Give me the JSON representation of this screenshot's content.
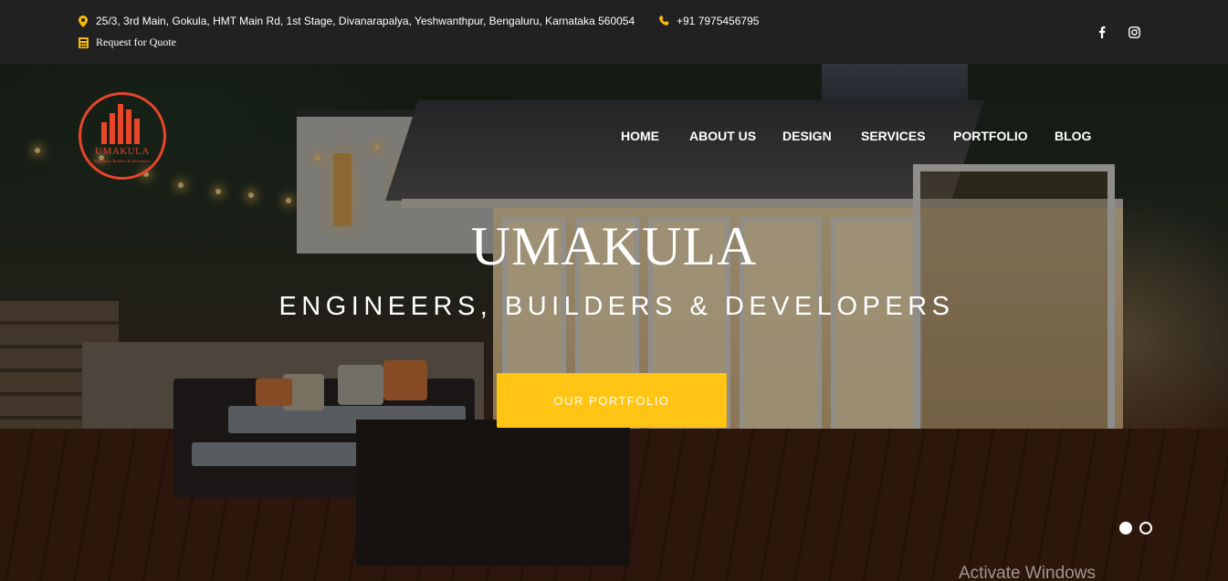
{
  "topbar": {
    "address": "25/3, 3rd Main, Gokula, HMT Main Rd, 1st Stage, Divanarapalya, Yeshwanthpur, Bengaluru, Karnataka 560054",
    "phone": "+91 7975456795",
    "quote": "Request for Quote",
    "icons": [
      "map-marker-icon",
      "phone-icon",
      "calculator-icon",
      "facebook-icon",
      "instagram-icon"
    ],
    "accent": "#f5b80c"
  },
  "logo": {
    "name": "UMAKULA",
    "tagline": "Engineers, Builders & Developers",
    "color": "#e8452b"
  },
  "nav": [
    "HOME",
    "ABOUT US",
    "DESIGN",
    "SERVICES",
    "PORTFOLIO",
    "BLOG"
  ],
  "hero": {
    "title": "UMAKULA",
    "subtitle": "ENGINEERS, BUILDERS & DEVELOPERS",
    "cta": "OUR PORTFOLIO",
    "cta_color": "#ffc414"
  },
  "slider": {
    "slides": 2,
    "active": 1
  },
  "watermark": "Activate Windows"
}
